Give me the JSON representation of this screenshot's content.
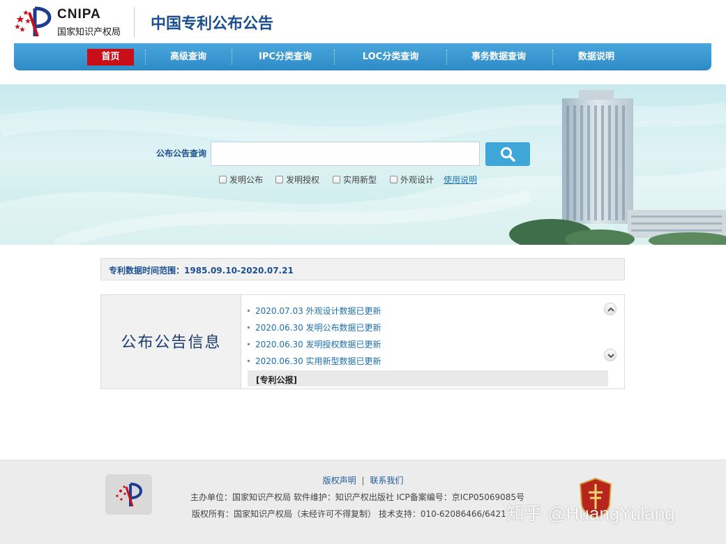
{
  "header": {
    "logo_en": "CNIPA",
    "logo_cn": "国家知识产权局",
    "site_title": "中国专利公布公告"
  },
  "nav": {
    "items": [
      {
        "label": "首页",
        "active": true
      },
      {
        "label": "高级查询"
      },
      {
        "label": "IPC分类查询"
      },
      {
        "label": "LOC分类查询"
      },
      {
        "label": "事务数据查询"
      },
      {
        "label": "数据说明"
      }
    ]
  },
  "search": {
    "label": "公布公告查询",
    "value": "",
    "options": [
      {
        "label": "发明公布",
        "checked": false
      },
      {
        "label": "发明授权",
        "checked": false
      },
      {
        "label": "实用新型",
        "checked": false
      },
      {
        "label": "外观设计",
        "checked": false
      }
    ],
    "help_link": "使用说明",
    "button_icon": "search-icon"
  },
  "data_range": "专利数据时间范围：1985.09.10-2020.07.21",
  "info": {
    "title": "公布公告信息",
    "news": [
      "2020.07.03 外观设计数据已更新",
      "2020.06.30 发明公布数据已更新",
      "2020.06.30 发明授权数据已更新",
      "2020.06.30 实用新型数据已更新"
    ],
    "gazette": "[专利公报]"
  },
  "footer": {
    "link_copyright": "版权声明",
    "link_separator": "|",
    "link_contact": "联系我们",
    "line1": "主办单位：国家知识产权局    软件维护：知识产权出版社    ICP备案编号：京ICP05069085号",
    "line2": "版权所有：国家知识产权局（未经许可不得复制）    技术支持：010-62086466/6421",
    "watermark": "知乎 @HuangYulang"
  },
  "colors": {
    "nav_bg": "#3a9bd4",
    "nav_active": "#c80e17",
    "title_blue": "#1b4f8f",
    "link_blue": "#1d6fb0",
    "search_button": "#3ea7d8"
  }
}
